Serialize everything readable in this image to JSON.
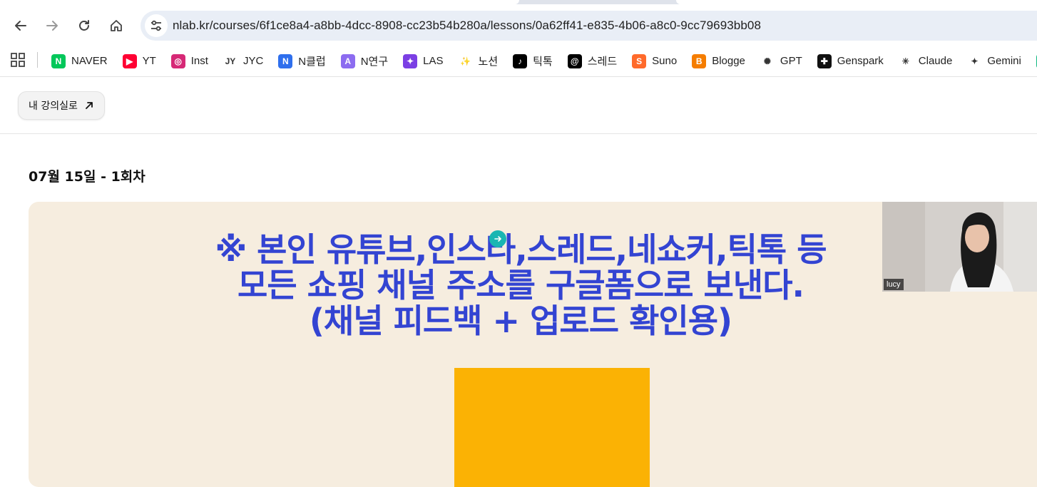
{
  "browser": {
    "url": "nlab.kr/courses/6f1ce8a4-a8bb-4dcc-8908-cc23b54b280a/lessons/0a62ff41-e835-4b06-a8c0-9cc79693bb08"
  },
  "bookmarks": [
    {
      "label": "NAVER",
      "icon": "naver-icon",
      "glyph": "N",
      "color": "#03c75a"
    },
    {
      "label": "YT",
      "icon": "youtube-icon",
      "glyph": "▶",
      "color": "#ff0033"
    },
    {
      "label": "Inst",
      "icon": "instagram-icon",
      "glyph": "◎",
      "color": "#d62976"
    },
    {
      "label": "JYC",
      "icon": "jyc-icon",
      "glyph": "JY",
      "color": "#ffffff"
    },
    {
      "label": "N클럽",
      "icon": "n-club-icon",
      "glyph": "N",
      "color": "#2f6fed"
    },
    {
      "label": "N연구",
      "icon": "n-research-icon",
      "glyph": "A",
      "color": "#8c6cf0"
    },
    {
      "label": "LAS",
      "icon": "las-icon",
      "glyph": "✦",
      "color": "#7b3fe4"
    },
    {
      "label": "노션",
      "icon": "notion-sparkle-icon",
      "glyph": "✨",
      "color": "#ffffff"
    },
    {
      "label": "틱톡",
      "icon": "tiktok-icon",
      "glyph": "♪",
      "color": "#000000"
    },
    {
      "label": "스레드",
      "icon": "threads-icon",
      "glyph": "@",
      "color": "#000000"
    },
    {
      "label": "Suno",
      "icon": "suno-icon",
      "glyph": "S",
      "color": "#ff6a2b"
    },
    {
      "label": "Blogge",
      "icon": "blogger-icon",
      "glyph": "B",
      "color": "#f57d00"
    },
    {
      "label": "GPT",
      "icon": "openai-icon",
      "glyph": "✺",
      "color": "#ffffff"
    },
    {
      "label": "Genspark",
      "icon": "genspark-icon",
      "glyph": "✚",
      "color": "#111111"
    },
    {
      "label": "Claude",
      "icon": "claude-icon",
      "glyph": "✳",
      "color": "#ffffff"
    },
    {
      "label": "Gemini",
      "icon": "gemini-icon",
      "glyph": "✦",
      "color": "#ffffff"
    },
    {
      "label": "",
      "icon": "extra-bookmark-icon",
      "glyph": "A",
      "color": "#10b981"
    }
  ],
  "page": {
    "back_button_label": "내 강의실로",
    "session_title": "07월 15일 - 1회차"
  },
  "slide": {
    "line1": "※ 본인 유튜브,인스타,스레드,네쇼커,틱톡 등",
    "line2": "모든 쇼핑 채널 주소를 구글폼으로 보낸다.",
    "line3": "(채널 피드백 + 업로드 확인용)"
  },
  "webcam": {
    "participant_name": "lucy"
  },
  "colors": {
    "slide_background": "#f6eddf",
    "slide_text": "#3344d2",
    "slide_box": "#fbb204"
  }
}
